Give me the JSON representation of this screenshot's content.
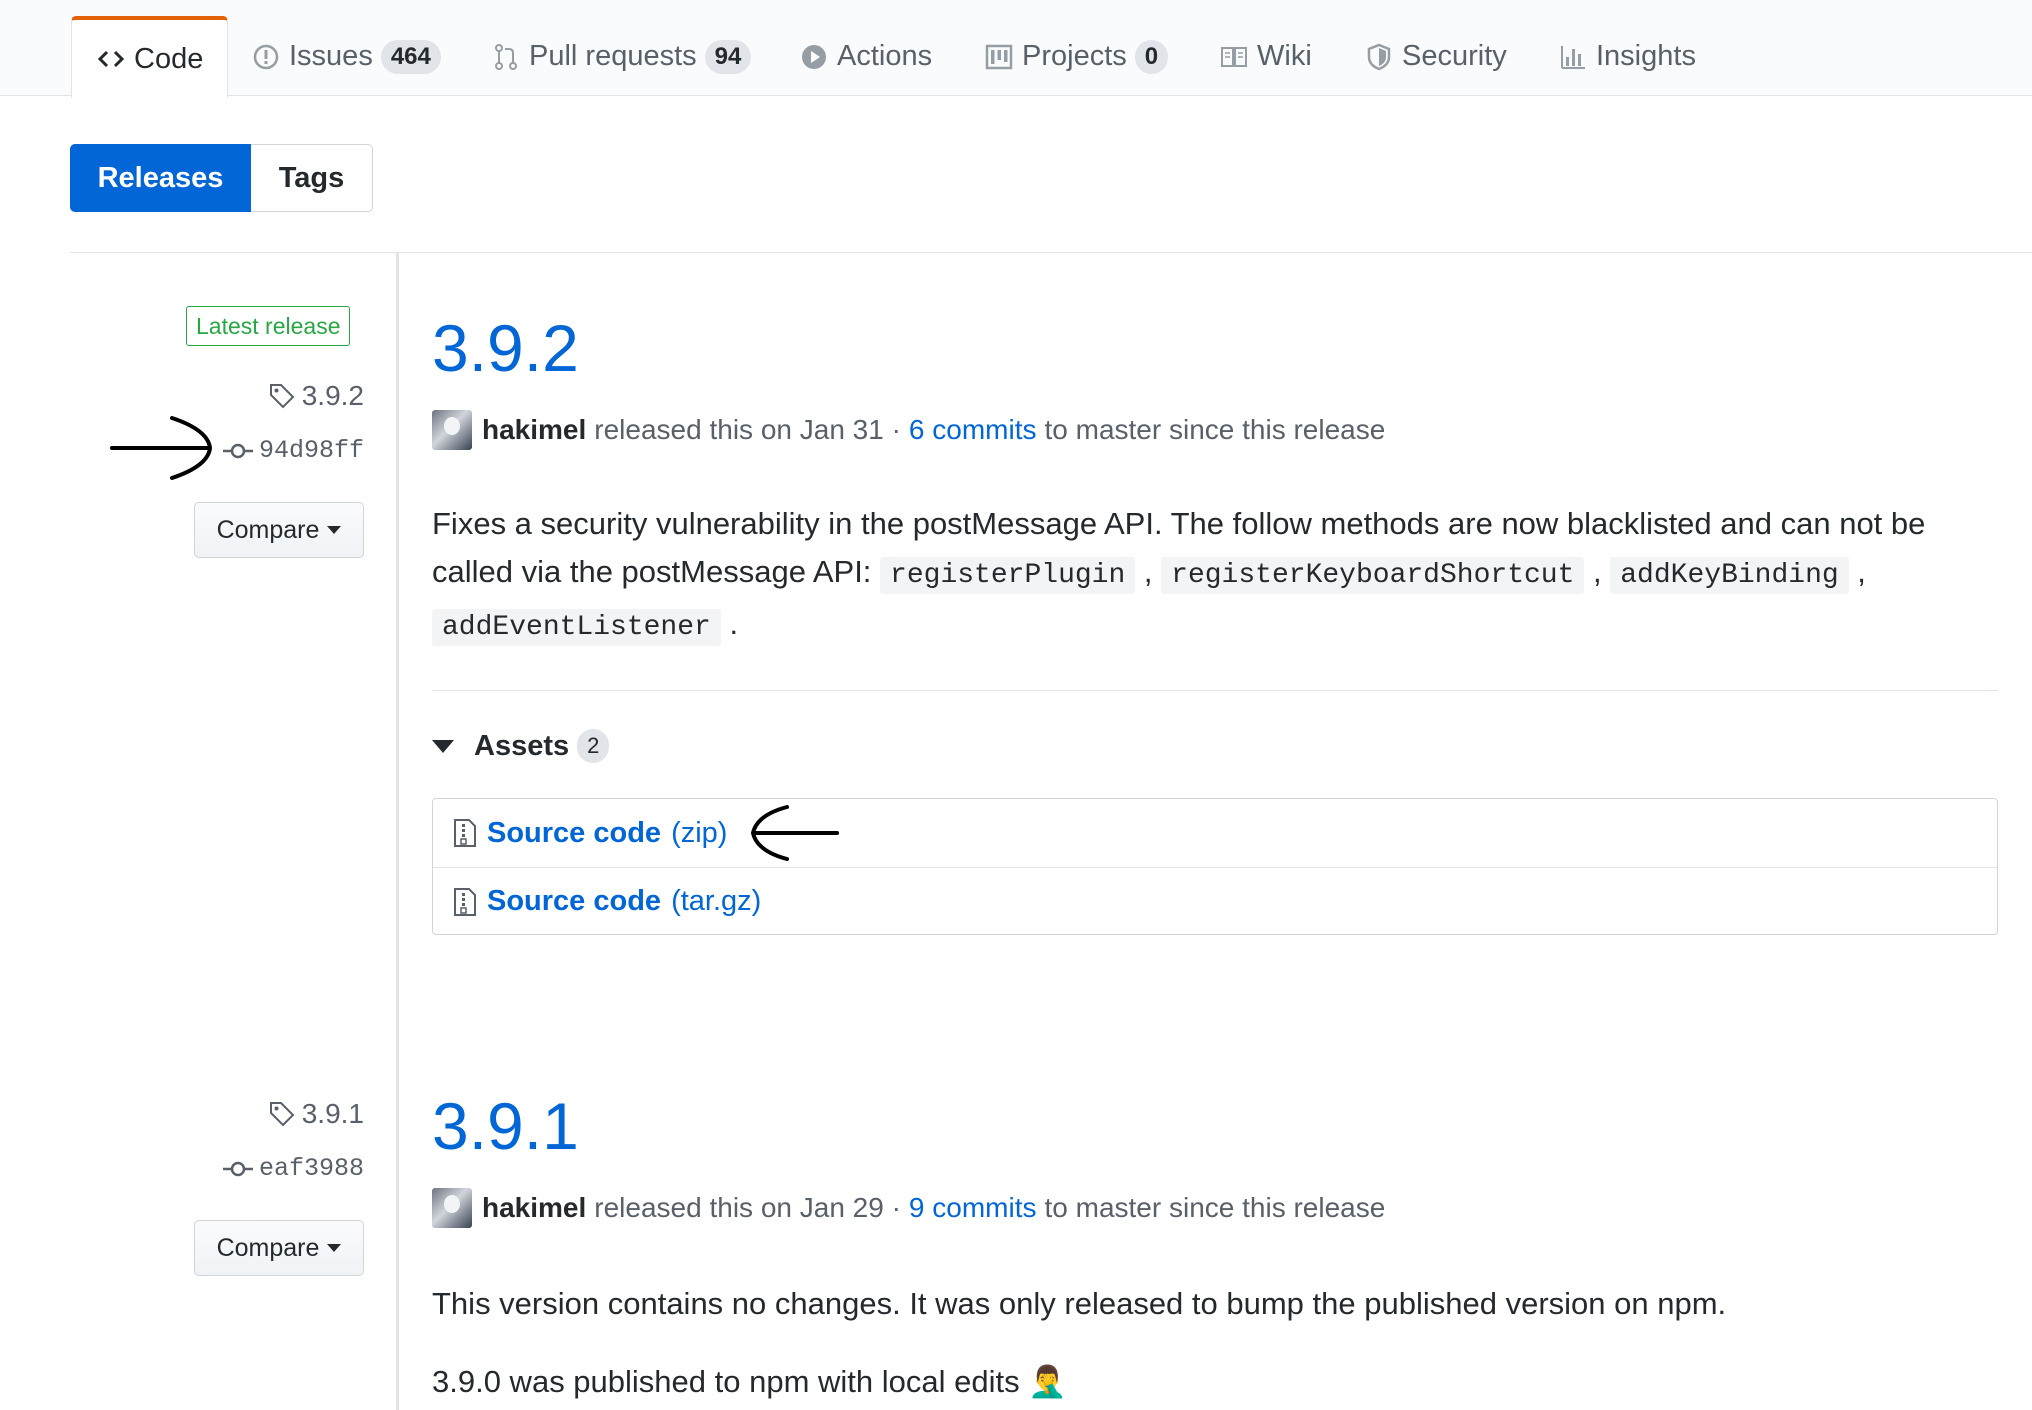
{
  "tabs": [
    {
      "label": "Code",
      "icon": "code-icon",
      "selected": true
    },
    {
      "label": "Issues",
      "count": "464",
      "icon": "issue-icon"
    },
    {
      "label": "Pull requests",
      "count": "94",
      "icon": "pull-request-icon"
    },
    {
      "label": "Actions",
      "icon": "play-icon"
    },
    {
      "label": "Projects",
      "count": "0",
      "icon": "project-icon"
    },
    {
      "label": "Wiki",
      "icon": "book-icon"
    },
    {
      "label": "Security",
      "icon": "shield-icon"
    },
    {
      "label": "Insights",
      "icon": "graph-icon"
    }
  ],
  "subnav": {
    "releases": "Releases",
    "tags": "Tags"
  },
  "releases": [
    {
      "badge": "Latest release",
      "tag": "3.9.2",
      "sha": "94d98ff",
      "compare": "Compare",
      "title": "3.9.2",
      "author": "hakimel",
      "released": "released this on Jan 31 ·",
      "commits": "6 commits",
      "since": "to master since this release",
      "body_text1": "Fixes a security vulnerability in the postMessage API. The follow methods are now blacklisted and can not be called via the postMessage API:",
      "methods": [
        "registerPlugin",
        "registerKeyboardShortcut",
        "addKeyBinding",
        "addEventListener"
      ],
      "assets_label": "Assets",
      "assets_count": "2",
      "assets": [
        {
          "name": "Source code",
          "format": "(zip)"
        },
        {
          "name": "Source code",
          "format": "(tar.gz)"
        }
      ]
    },
    {
      "tag": "3.9.1",
      "sha": "eaf3988",
      "compare": "Compare",
      "title": "3.9.1",
      "author": "hakimel",
      "released": "released this on Jan 29 ·",
      "commits": "9 commits",
      "since": "to master since this release",
      "body_para1": "This version contains no changes. It was only released to bump the published version on npm.",
      "body_para2": "3.9.0 was published to npm with local edits",
      "emoji": "🤦‍♂️"
    }
  ],
  "colors": {
    "link": "#0366d6",
    "accent_tab": "#e36209",
    "badge_green": "#28a745"
  }
}
